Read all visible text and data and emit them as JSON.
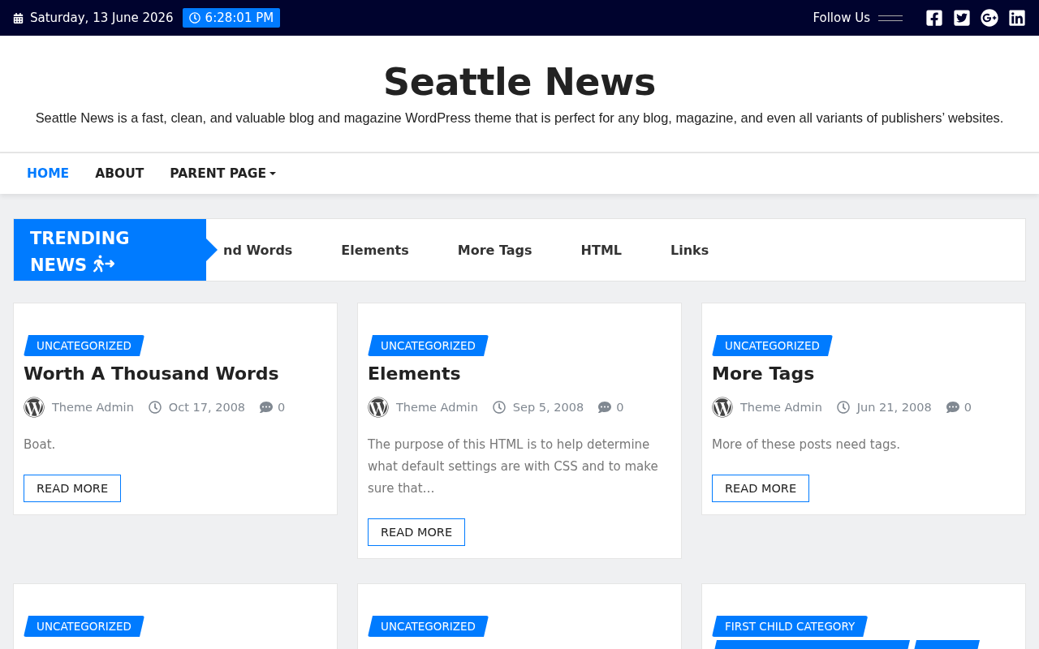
{
  "top_bar": {
    "date": "Saturday, 13 June 2026",
    "time": "6:28:01 PM",
    "follow_label": "Follow Us",
    "social": [
      {
        "kind": "facebook"
      },
      {
        "kind": "twitter"
      },
      {
        "kind": "googleplus"
      },
      {
        "kind": "linkedin"
      }
    ]
  },
  "header": {
    "title": "Seattle News",
    "tagline": "Seattle News is a fast, clean, and valuable blog and magazine WordPress theme that is perfect for any blog, magazine, and even all variants of publishers’ websites."
  },
  "nav": [
    {
      "label": "HOME",
      "selected": true,
      "dropdown": false
    },
    {
      "label": "ABOUT",
      "selected": false,
      "dropdown": false
    },
    {
      "label": "PARENT PAGE",
      "selected": false,
      "dropdown": true
    }
  ],
  "trending": {
    "label_line1": "TRENDING",
    "label_line2": "NEWS",
    "items": [
      "nd Words",
      "Elements",
      "More Tags",
      "HTML",
      "Links"
    ]
  },
  "posts": [
    {
      "categories": [
        {
          "kind": "label",
          "label": "UNCATEGORIZED"
        }
      ],
      "title": "Worth A Thousand Words",
      "author": "Theme Admin",
      "date": "Oct 17, 2008",
      "comments": "0",
      "excerpt": "Boat.",
      "button": "READ MORE"
    },
    {
      "categories": [
        {
          "kind": "label",
          "label": "UNCATEGORIZED"
        }
      ],
      "title": "Elements",
      "author": "Theme Admin",
      "date": "Sep 5, 2008",
      "comments": "0",
      "excerpt": "The purpose of this HTML is to help determine what default settings are with CSS and to make sure that…",
      "button": "READ MORE"
    },
    {
      "categories": [
        {
          "kind": "label",
          "label": "UNCATEGORIZED"
        }
      ],
      "title": "More Tags",
      "author": "Theme Admin",
      "date": "Jun 21, 2008",
      "comments": "0",
      "excerpt": "More of these posts need tags.",
      "button": "READ MORE"
    },
    {
      "categories": [
        {
          "kind": "label",
          "label": "UNCATEGORIZED"
        }
      ]
    },
    {
      "categories": [
        {
          "kind": "label",
          "label": "UNCATEGORIZED"
        }
      ]
    },
    {
      "categories": [
        {
          "kind": "label",
          "label": "FIRST CHILD CATEGORY"
        },
        {
          "kind": "wide"
        },
        {
          "kind": "narrow"
        }
      ]
    }
  ]
}
